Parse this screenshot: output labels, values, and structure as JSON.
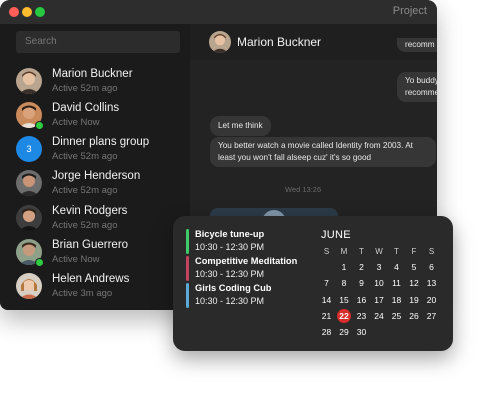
{
  "window": {
    "title": "Project"
  },
  "sidebar": {
    "search_placeholder": "Search",
    "contacts": [
      {
        "name": "Marion Buckner",
        "status": "Active 52m ago",
        "online": false
      },
      {
        "name": "David Collins",
        "status": "Active Now",
        "online": true
      },
      {
        "name": "Dinner plans group",
        "status": "Active 52m ago",
        "online": false,
        "avatar_text": "3"
      },
      {
        "name": "Jorge Henderson",
        "status": "Active 52m ago",
        "online": false
      },
      {
        "name": "Kevin Rodgers",
        "status": "Active 52m ago",
        "online": false
      },
      {
        "name": "Brian Guerrero",
        "status": "Active Now",
        "online": true
      },
      {
        "name": "Helen Andrews",
        "status": "Active 3m ago",
        "online": false
      }
    ]
  },
  "chat": {
    "contact_name": "Marion Buckner",
    "messages": [
      {
        "direction": "out",
        "text": "recomm"
      },
      {
        "direction": "out",
        "text": "Yo buddy\nrecomme"
      },
      {
        "direction": "in",
        "text": "Let me think"
      },
      {
        "direction": "in",
        "text": "You better watch a movie called Identity from 2003. At least you won't fall alseep cuz' it's so good"
      }
    ],
    "timestamp": "Wed 13:26"
  },
  "widget": {
    "events": [
      {
        "title": "Bicycle tune-up",
        "time": "10:30 - 12:30 PM",
        "color": "#3dcc6a"
      },
      {
        "title": "Competitive Meditation",
        "time": "10:30 - 12:30 PM",
        "color": "#c4445f"
      },
      {
        "title": "Girls Coding Cub",
        "time": "10:30 - 12:30 PM",
        "color": "#5aa9d6"
      }
    ],
    "calendar": {
      "month": "JUNE",
      "weekdays": [
        "S",
        "M",
        "T",
        "W",
        "T",
        "F",
        "S"
      ],
      "weeks": [
        [
          "",
          "1",
          "2",
          "3",
          "4",
          "5",
          "6"
        ],
        [
          "7",
          "8",
          "9",
          "10",
          "11",
          "12",
          "13"
        ],
        [
          "14",
          "15",
          "16",
          "17",
          "18",
          "19",
          "20"
        ],
        [
          "21",
          "22",
          "23",
          "24",
          "25",
          "26",
          "27"
        ],
        [
          "28",
          "29",
          "30",
          "",
          "",
          "",
          ""
        ]
      ],
      "today": "22",
      "today_color": "#d82c2c"
    }
  }
}
